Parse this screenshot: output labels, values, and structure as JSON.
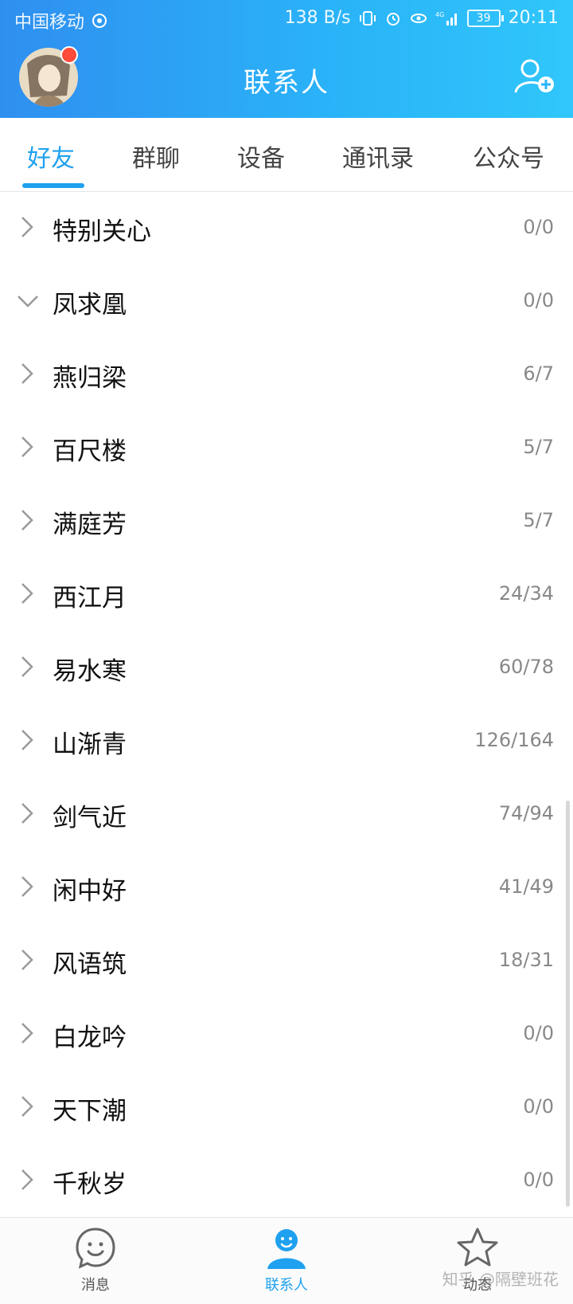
{
  "status_bar": {
    "carrier": "中国移动",
    "net_speed": "138 B/s",
    "network": "4G",
    "battery": "39",
    "time": "20:11"
  },
  "header": {
    "title": "联系人",
    "colors": {
      "gradient_start": "#2f8ff0",
      "gradient_end": "#30c6fb"
    }
  },
  "tabs": [
    {
      "label": "好友",
      "active": true
    },
    {
      "label": "群聊",
      "active": false
    },
    {
      "label": "设备",
      "active": false
    },
    {
      "label": "通讯录",
      "active": false
    },
    {
      "label": "公众号",
      "active": false
    }
  ],
  "groups": [
    {
      "name": "特别关心",
      "count": "0/0",
      "expanded": false
    },
    {
      "name": "凤求凰",
      "count": "0/0",
      "expanded": true
    },
    {
      "name": "燕归梁",
      "count": "6/7",
      "expanded": false
    },
    {
      "name": "百尺楼",
      "count": "5/7",
      "expanded": false
    },
    {
      "name": "满庭芳",
      "count": "5/7",
      "expanded": false
    },
    {
      "name": "西江月",
      "count": "24/34",
      "expanded": false
    },
    {
      "name": "易水寒",
      "count": "60/78",
      "expanded": false
    },
    {
      "name": "山渐青",
      "count": "126/164",
      "expanded": false
    },
    {
      "name": "剑气近",
      "count": "74/94",
      "expanded": false
    },
    {
      "name": "闲中好",
      "count": "41/49",
      "expanded": false
    },
    {
      "name": "风语筑",
      "count": "18/31",
      "expanded": false
    },
    {
      "name": "白龙吟",
      "count": "0/0",
      "expanded": false
    },
    {
      "name": "天下潮",
      "count": "0/0",
      "expanded": false
    },
    {
      "name": "千秋岁",
      "count": "0/0",
      "expanded": false
    }
  ],
  "bottom_nav": [
    {
      "label": "消息",
      "icon": "smile-face-icon",
      "active": false
    },
    {
      "label": "联系人",
      "icon": "contact-person-icon",
      "active": true
    },
    {
      "label": "动态",
      "icon": "star-icon",
      "active": false
    }
  ],
  "watermark": "知乎 @隔壁班花"
}
